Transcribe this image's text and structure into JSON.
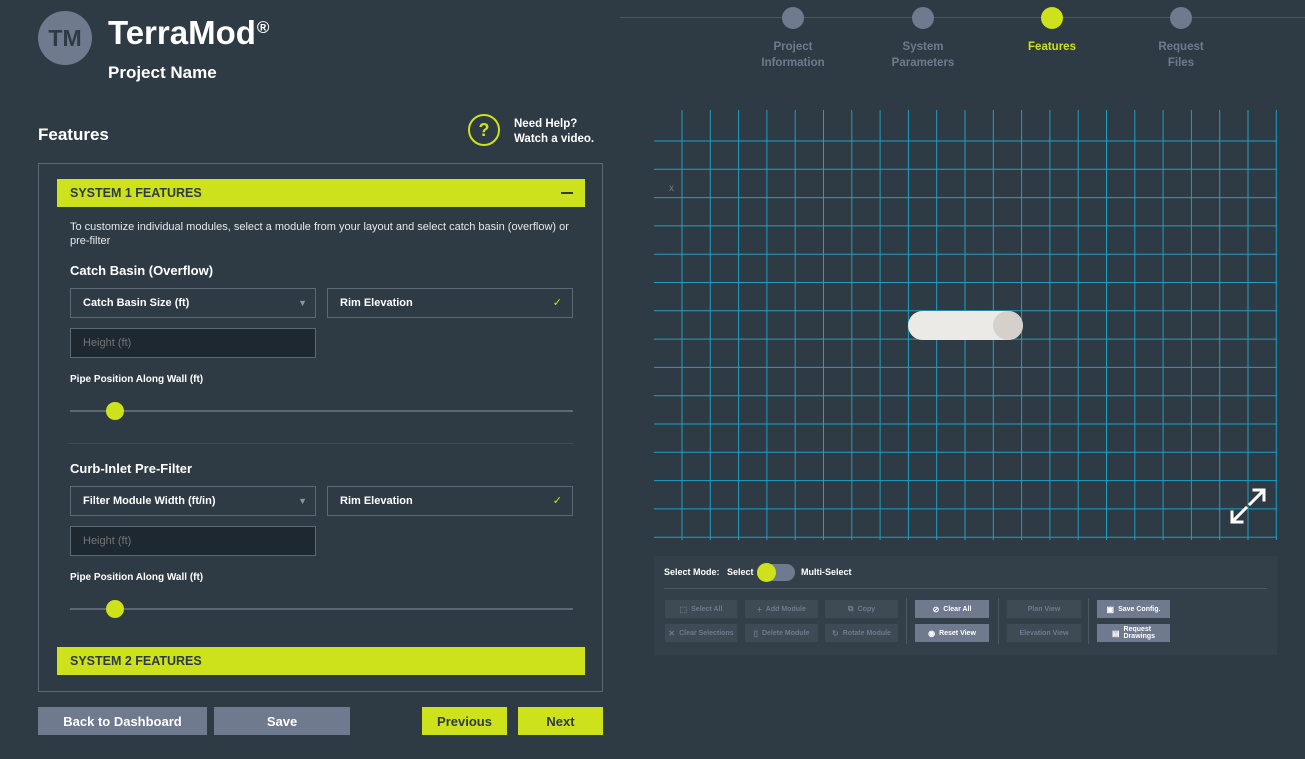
{
  "header": {
    "avatar_initials": "TM",
    "brand": "TerraMod",
    "brand_mark": "®",
    "project_name": "Project Name"
  },
  "stepper": {
    "steps": [
      {
        "label_line1": "Project",
        "label_line2": "Information",
        "active": false
      },
      {
        "label_line1": "System",
        "label_line2": "Parameters",
        "active": false
      },
      {
        "label_line1": "Features",
        "label_line2": "",
        "active": true
      },
      {
        "label_line1": "Request",
        "label_line2": "Files",
        "active": false
      }
    ]
  },
  "features": {
    "heading": "Features",
    "help_icon": "?",
    "help_line1": "Need Help?",
    "help_line2": "Watch a video."
  },
  "system1": {
    "title": "SYSTEM 1 FEATURES",
    "description": "To customize individual modules, select a module from your layout and select catch basin (overflow) or pre-filter",
    "catch_basin": {
      "title": "Catch Basin (Overflow)",
      "size_select": "Catch Basin Size (ft)",
      "rim_elevation": "Rim Elevation",
      "height_placeholder": "Height (ft)",
      "slider_label": "Pipe Position Along Wall (ft)",
      "slider_value": 0.09
    },
    "pre_filter": {
      "title": "Curb-Inlet Pre-Filter",
      "width_select": "Filter Module Width (ft/in)",
      "rim_elevation": "Rim Elevation",
      "height_placeholder": "Height (ft)",
      "slider_label": "Pipe Position Along Wall (ft)",
      "slider_value": 0.09
    },
    "check_mark": "✓",
    "caret": "▼"
  },
  "system2": {
    "title": "SYSTEM 2 FEATURES"
  },
  "footer": {
    "back_label": "Back to Dashboard",
    "save_label": "Save",
    "previous_label": "Previous",
    "next_label": "Next"
  },
  "grid": {
    "axis_marker": "x"
  },
  "toolbar": {
    "select_mode_label": "Select Mode:",
    "mode_select": "Select",
    "mode_multi": "Multi-Select",
    "buttons": {
      "select_all": "Select All",
      "add_module": "Add Module",
      "copy": "Copy",
      "clear_all": "Clear All",
      "plan_view": "Plan View",
      "save_config": "Save Config.",
      "clear_selections": "Clear Selections",
      "delete_module": "Delete Module",
      "rotate_module": "Rotate Module",
      "reset_view": "Reset View",
      "elevation_view": "Elevation View",
      "request_drawings_line1": "Request",
      "request_drawings_line2": "Drawings"
    }
  },
  "colors": {
    "background": "#2f3b44",
    "accent": "#cde21b",
    "muted": "#6f7a8e",
    "grid_line": "#1f9fc4"
  }
}
